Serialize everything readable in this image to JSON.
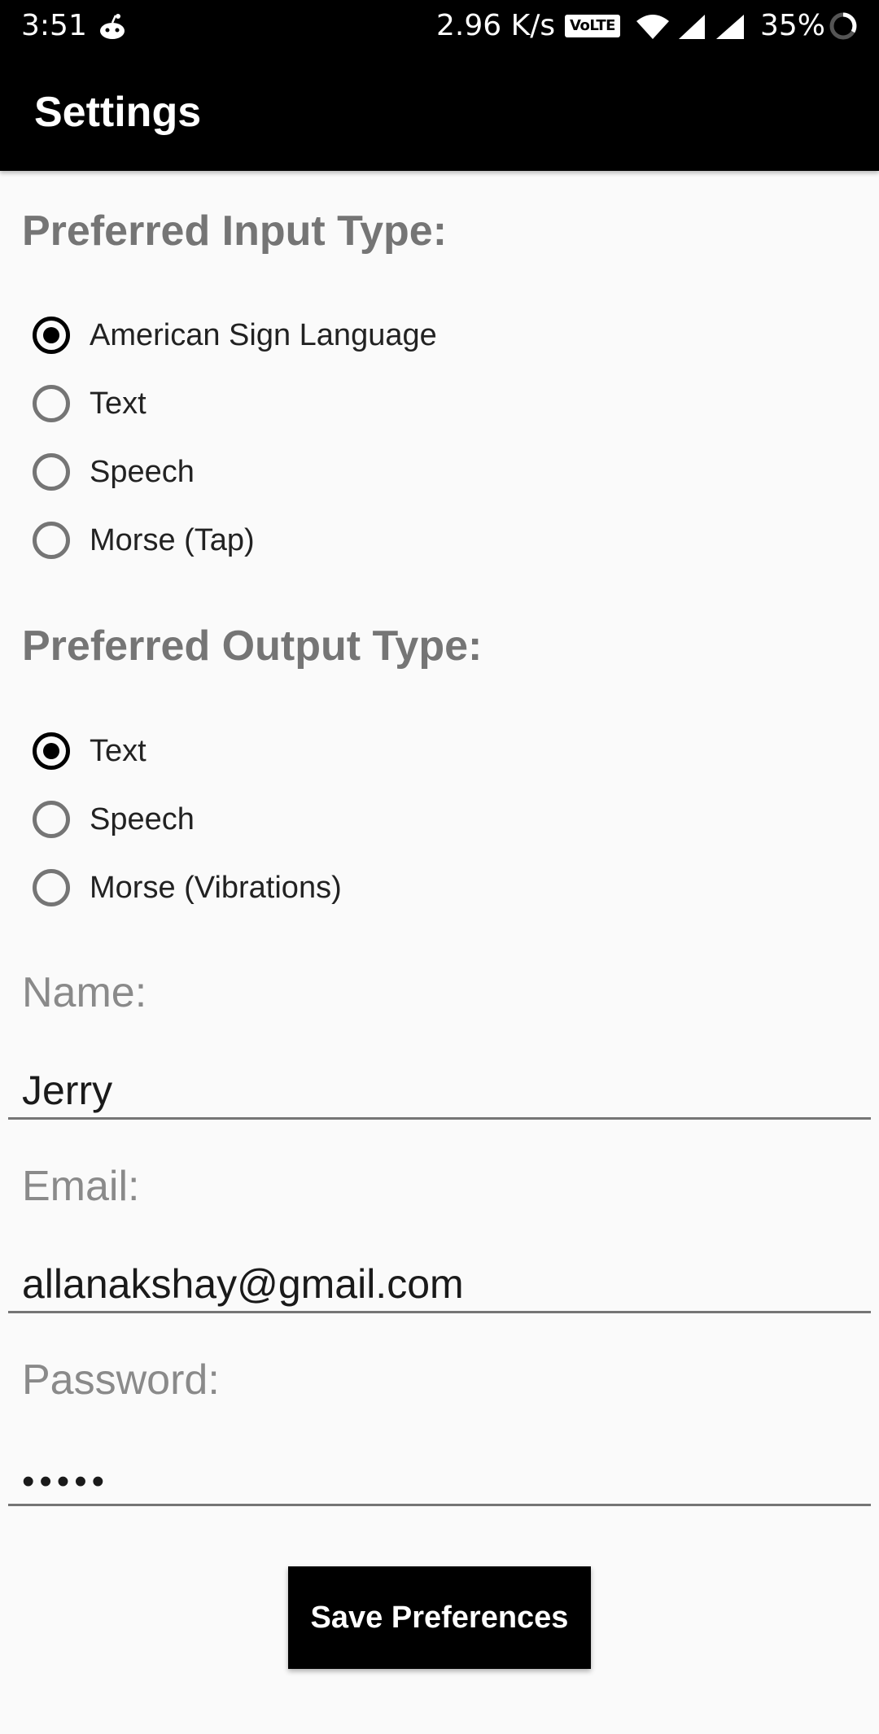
{
  "status_bar": {
    "time": "3:51",
    "network_speed": "2.96 K/s",
    "volte_label": "VoLTE",
    "battery_percent": "35%",
    "icons": [
      "notification-icon",
      "volte-icon",
      "wifi-icon",
      "signal-icon",
      "signal-icon",
      "battery-icon"
    ]
  },
  "app_bar": {
    "title": "Settings"
  },
  "input_section": {
    "heading": "Preferred Input Type:",
    "options": [
      {
        "label": "American Sign Language",
        "selected": true
      },
      {
        "label": "Text",
        "selected": false
      },
      {
        "label": "Speech",
        "selected": false
      },
      {
        "label": "Morse (Tap)",
        "selected": false
      }
    ]
  },
  "output_section": {
    "heading": "Preferred Output Type:",
    "options": [
      {
        "label": "Text",
        "selected": true
      },
      {
        "label": "Speech",
        "selected": false
      },
      {
        "label": "Morse (Vibrations)",
        "selected": false
      }
    ]
  },
  "fields": {
    "name": {
      "label": "Name:",
      "value": "Jerry"
    },
    "email": {
      "label": "Email:",
      "value": "allanakshay@gmail.com"
    },
    "password": {
      "label": "Password:",
      "value": "•••••"
    }
  },
  "save_button": {
    "label": "Save Preferences"
  },
  "colors": {
    "app_bar": "#000000",
    "background": "#fafafa",
    "heading": "#757575",
    "button": "#000000"
  }
}
